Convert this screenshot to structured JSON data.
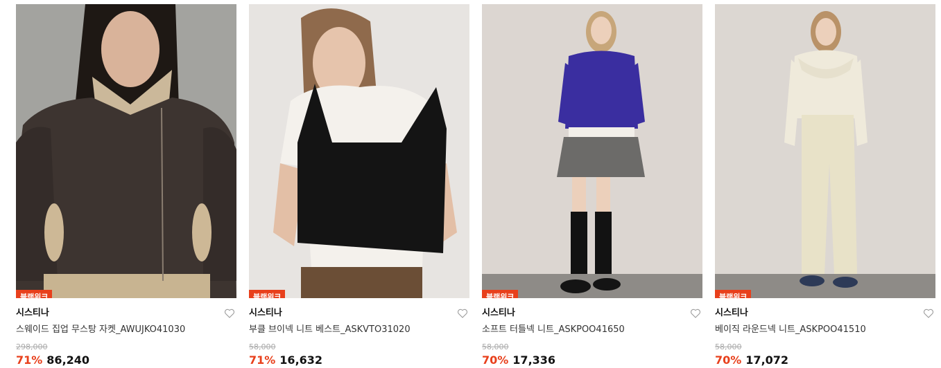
{
  "products": [
    {
      "badge": "블랙위크",
      "brand": "시스티나",
      "name": "스웨이드 집업 무스탕 자켓_AWUJKO41030",
      "original_price": "298,000",
      "discount": "71%",
      "price": "86,240",
      "image_icon": "product-photo-jacket"
    },
    {
      "badge": "블랙위크",
      "brand": "시스티나",
      "name": "부클 브이넥 니트 베스트_ASKVTO31020",
      "original_price": "58,000",
      "discount": "71%",
      "price": "16,632",
      "image_icon": "product-photo-vest"
    },
    {
      "badge": "블랙위크",
      "brand": "시스티나",
      "name": "소프트 터틀넥 니트_ASKPOO41650",
      "original_price": "58,000",
      "discount": "70%",
      "price": "17,336",
      "image_icon": "product-photo-turtleneck"
    },
    {
      "badge": "블랙위크",
      "brand": "시스티나",
      "name": "베이직 라운드넥 니트_ASKPOO41510",
      "original_price": "58,000",
      "discount": "70%",
      "price": "17,072",
      "image_icon": "product-photo-roundneck"
    }
  ],
  "colors": {
    "accent": "#e8401c",
    "strike": "#aaaaaa",
    "heart_outline": "#999999"
  }
}
